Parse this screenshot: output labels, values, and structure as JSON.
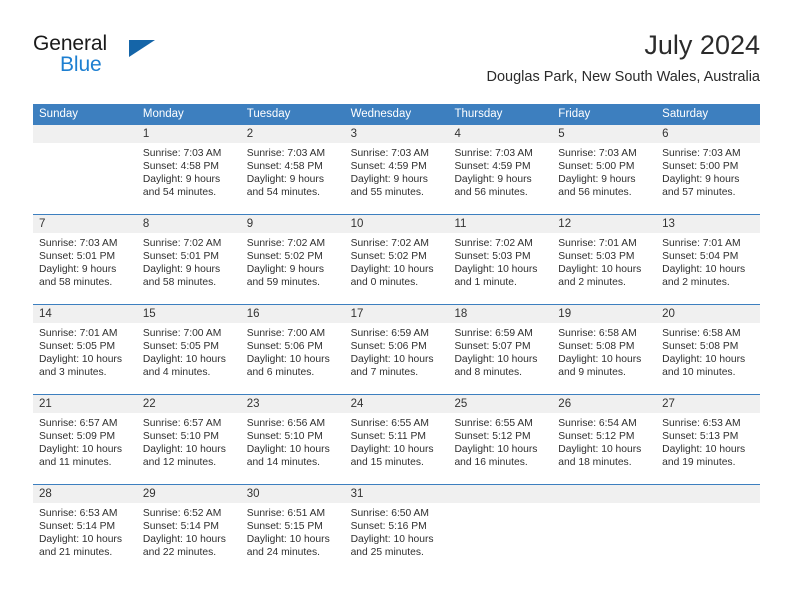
{
  "brand": {
    "word_one": "General",
    "word_two": "Blue",
    "logo_icon": "triangle-logo-icon",
    "accent_color": "#1d7fd1",
    "triangle_color": "#1565a8"
  },
  "header": {
    "title": "July 2024",
    "location": "Douglas Park, New South Wales, Australia"
  },
  "calendar": {
    "header_bg": "#3d7fbf",
    "header_text_color": "#ffffff",
    "daynum_bg": "#f0f0f0",
    "weekdays": [
      "Sunday",
      "Monday",
      "Tuesday",
      "Wednesday",
      "Thursday",
      "Friday",
      "Saturday"
    ],
    "weeks": [
      [
        {
          "day": "",
          "sunrise": "",
          "sunset": "",
          "daylight_1": "",
          "daylight_2": ""
        },
        {
          "day": "1",
          "sunrise": "Sunrise: 7:03 AM",
          "sunset": "Sunset: 4:58 PM",
          "daylight_1": "Daylight: 9 hours",
          "daylight_2": "and 54 minutes."
        },
        {
          "day": "2",
          "sunrise": "Sunrise: 7:03 AM",
          "sunset": "Sunset: 4:58 PM",
          "daylight_1": "Daylight: 9 hours",
          "daylight_2": "and 54 minutes."
        },
        {
          "day": "3",
          "sunrise": "Sunrise: 7:03 AM",
          "sunset": "Sunset: 4:59 PM",
          "daylight_1": "Daylight: 9 hours",
          "daylight_2": "and 55 minutes."
        },
        {
          "day": "4",
          "sunrise": "Sunrise: 7:03 AM",
          "sunset": "Sunset: 4:59 PM",
          "daylight_1": "Daylight: 9 hours",
          "daylight_2": "and 56 minutes."
        },
        {
          "day": "5",
          "sunrise": "Sunrise: 7:03 AM",
          "sunset": "Sunset: 5:00 PM",
          "daylight_1": "Daylight: 9 hours",
          "daylight_2": "and 56 minutes."
        },
        {
          "day": "6",
          "sunrise": "Sunrise: 7:03 AM",
          "sunset": "Sunset: 5:00 PM",
          "daylight_1": "Daylight: 9 hours",
          "daylight_2": "and 57 minutes."
        }
      ],
      [
        {
          "day": "7",
          "sunrise": "Sunrise: 7:03 AM",
          "sunset": "Sunset: 5:01 PM",
          "daylight_1": "Daylight: 9 hours",
          "daylight_2": "and 58 minutes."
        },
        {
          "day": "8",
          "sunrise": "Sunrise: 7:02 AM",
          "sunset": "Sunset: 5:01 PM",
          "daylight_1": "Daylight: 9 hours",
          "daylight_2": "and 58 minutes."
        },
        {
          "day": "9",
          "sunrise": "Sunrise: 7:02 AM",
          "sunset": "Sunset: 5:02 PM",
          "daylight_1": "Daylight: 9 hours",
          "daylight_2": "and 59 minutes."
        },
        {
          "day": "10",
          "sunrise": "Sunrise: 7:02 AM",
          "sunset": "Sunset: 5:02 PM",
          "daylight_1": "Daylight: 10 hours",
          "daylight_2": "and 0 minutes."
        },
        {
          "day": "11",
          "sunrise": "Sunrise: 7:02 AM",
          "sunset": "Sunset: 5:03 PM",
          "daylight_1": "Daylight: 10 hours",
          "daylight_2": "and 1 minute."
        },
        {
          "day": "12",
          "sunrise": "Sunrise: 7:01 AM",
          "sunset": "Sunset: 5:03 PM",
          "daylight_1": "Daylight: 10 hours",
          "daylight_2": "and 2 minutes."
        },
        {
          "day": "13",
          "sunrise": "Sunrise: 7:01 AM",
          "sunset": "Sunset: 5:04 PM",
          "daylight_1": "Daylight: 10 hours",
          "daylight_2": "and 2 minutes."
        }
      ],
      [
        {
          "day": "14",
          "sunrise": "Sunrise: 7:01 AM",
          "sunset": "Sunset: 5:05 PM",
          "daylight_1": "Daylight: 10 hours",
          "daylight_2": "and 3 minutes."
        },
        {
          "day": "15",
          "sunrise": "Sunrise: 7:00 AM",
          "sunset": "Sunset: 5:05 PM",
          "daylight_1": "Daylight: 10 hours",
          "daylight_2": "and 4 minutes."
        },
        {
          "day": "16",
          "sunrise": "Sunrise: 7:00 AM",
          "sunset": "Sunset: 5:06 PM",
          "daylight_1": "Daylight: 10 hours",
          "daylight_2": "and 6 minutes."
        },
        {
          "day": "17",
          "sunrise": "Sunrise: 6:59 AM",
          "sunset": "Sunset: 5:06 PM",
          "daylight_1": "Daylight: 10 hours",
          "daylight_2": "and 7 minutes."
        },
        {
          "day": "18",
          "sunrise": "Sunrise: 6:59 AM",
          "sunset": "Sunset: 5:07 PM",
          "daylight_1": "Daylight: 10 hours",
          "daylight_2": "and 8 minutes."
        },
        {
          "day": "19",
          "sunrise": "Sunrise: 6:58 AM",
          "sunset": "Sunset: 5:08 PM",
          "daylight_1": "Daylight: 10 hours",
          "daylight_2": "and 9 minutes."
        },
        {
          "day": "20",
          "sunrise": "Sunrise: 6:58 AM",
          "sunset": "Sunset: 5:08 PM",
          "daylight_1": "Daylight: 10 hours",
          "daylight_2": "and 10 minutes."
        }
      ],
      [
        {
          "day": "21",
          "sunrise": "Sunrise: 6:57 AM",
          "sunset": "Sunset: 5:09 PM",
          "daylight_1": "Daylight: 10 hours",
          "daylight_2": "and 11 minutes."
        },
        {
          "day": "22",
          "sunrise": "Sunrise: 6:57 AM",
          "sunset": "Sunset: 5:10 PM",
          "daylight_1": "Daylight: 10 hours",
          "daylight_2": "and 12 minutes."
        },
        {
          "day": "23",
          "sunrise": "Sunrise: 6:56 AM",
          "sunset": "Sunset: 5:10 PM",
          "daylight_1": "Daylight: 10 hours",
          "daylight_2": "and 14 minutes."
        },
        {
          "day": "24",
          "sunrise": "Sunrise: 6:55 AM",
          "sunset": "Sunset: 5:11 PM",
          "daylight_1": "Daylight: 10 hours",
          "daylight_2": "and 15 minutes."
        },
        {
          "day": "25",
          "sunrise": "Sunrise: 6:55 AM",
          "sunset": "Sunset: 5:12 PM",
          "daylight_1": "Daylight: 10 hours",
          "daylight_2": "and 16 minutes."
        },
        {
          "day": "26",
          "sunrise": "Sunrise: 6:54 AM",
          "sunset": "Sunset: 5:12 PM",
          "daylight_1": "Daylight: 10 hours",
          "daylight_2": "and 18 minutes."
        },
        {
          "day": "27",
          "sunrise": "Sunrise: 6:53 AM",
          "sunset": "Sunset: 5:13 PM",
          "daylight_1": "Daylight: 10 hours",
          "daylight_2": "and 19 minutes."
        }
      ],
      [
        {
          "day": "28",
          "sunrise": "Sunrise: 6:53 AM",
          "sunset": "Sunset: 5:14 PM",
          "daylight_1": "Daylight: 10 hours",
          "daylight_2": "and 21 minutes."
        },
        {
          "day": "29",
          "sunrise": "Sunrise: 6:52 AM",
          "sunset": "Sunset: 5:14 PM",
          "daylight_1": "Daylight: 10 hours",
          "daylight_2": "and 22 minutes."
        },
        {
          "day": "30",
          "sunrise": "Sunrise: 6:51 AM",
          "sunset": "Sunset: 5:15 PM",
          "daylight_1": "Daylight: 10 hours",
          "daylight_2": "and 24 minutes."
        },
        {
          "day": "31",
          "sunrise": "Sunrise: 6:50 AM",
          "sunset": "Sunset: 5:16 PM",
          "daylight_1": "Daylight: 10 hours",
          "daylight_2": "and 25 minutes."
        },
        {
          "day": "",
          "sunrise": "",
          "sunset": "",
          "daylight_1": "",
          "daylight_2": ""
        },
        {
          "day": "",
          "sunrise": "",
          "sunset": "",
          "daylight_1": "",
          "daylight_2": ""
        },
        {
          "day": "",
          "sunrise": "",
          "sunset": "",
          "daylight_1": "",
          "daylight_2": ""
        }
      ]
    ]
  }
}
